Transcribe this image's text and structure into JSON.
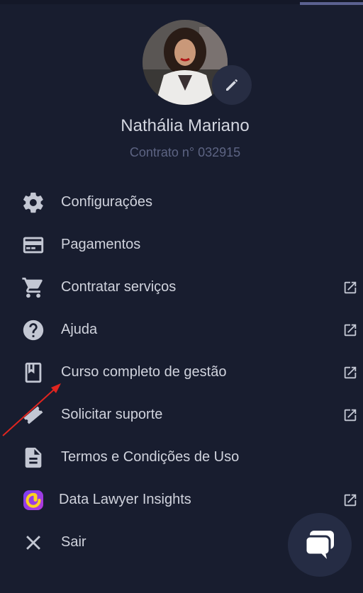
{
  "profile": {
    "name": "Nathália Mariano",
    "contract": "Contrato n° 032915",
    "avatar_icon": "user-photo",
    "edit_icon": "pencil-icon"
  },
  "menu": {
    "items": [
      {
        "label": "Configurações",
        "icon": "gear-icon",
        "external": false
      },
      {
        "label": "Pagamentos",
        "icon": "credit-card-icon",
        "external": false
      },
      {
        "label": "Contratar serviços",
        "icon": "cart-icon",
        "external": true
      },
      {
        "label": "Ajuda",
        "icon": "help-icon",
        "external": true
      },
      {
        "label": "Curso completo de gestão",
        "icon": "book-icon",
        "external": true
      },
      {
        "label": "Solicitar suporte",
        "icon": "ticket-icon",
        "external": true
      },
      {
        "label": "Termos e Condições de Uso",
        "icon": "document-icon",
        "external": false
      },
      {
        "label": "Data Lawyer Insights",
        "icon": "insights-logo-icon",
        "external": true
      },
      {
        "label": "Sair",
        "icon": "close-icon",
        "external": false
      }
    ]
  },
  "colors": {
    "background": "#181d2f",
    "text": "#d0d3dd",
    "muted": "#5d6483",
    "icon": "#c3c7d3",
    "annotation_arrow": "#e0251f"
  },
  "chat_button": {
    "icon": "chat-bubbles-icon"
  }
}
